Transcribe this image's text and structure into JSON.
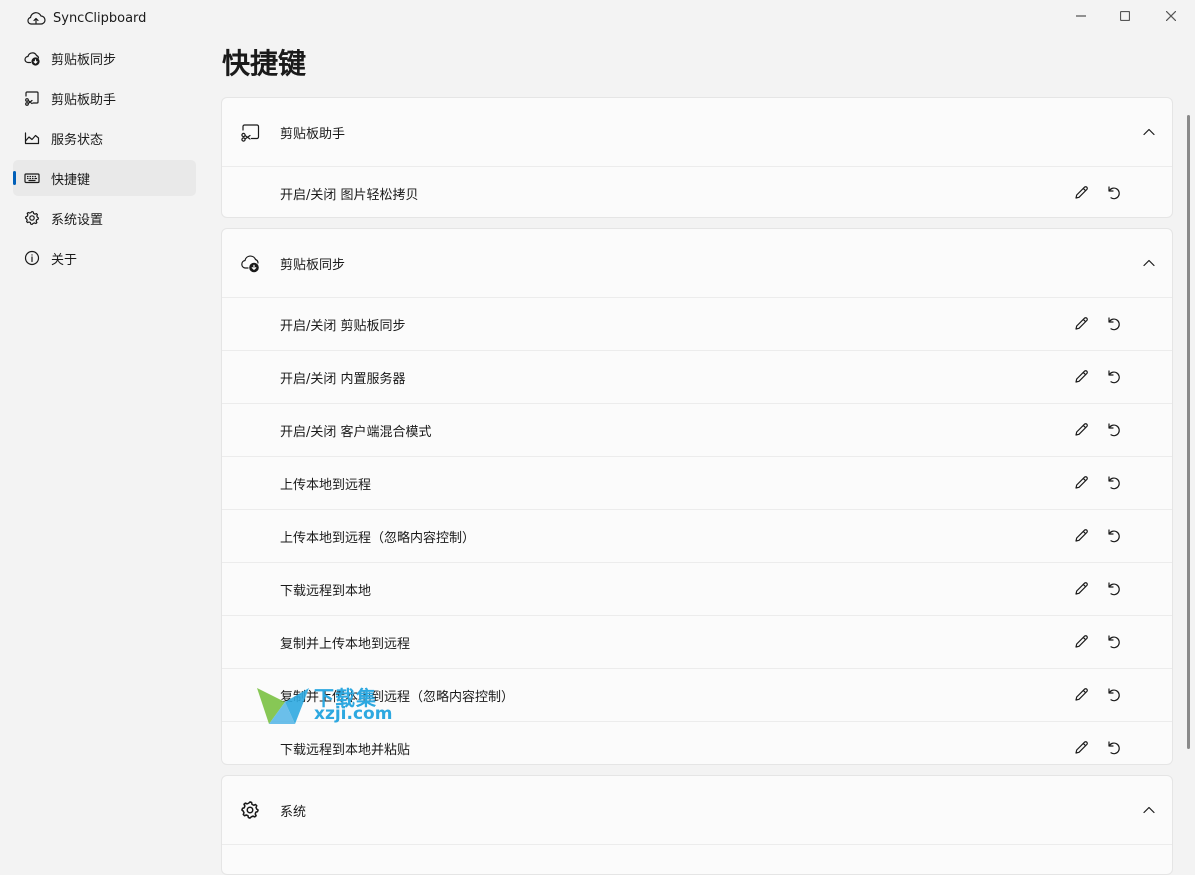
{
  "app": {
    "title": "SyncClipboard",
    "icons": {
      "app": "cloud-sync-icon",
      "minimize": "minimize-icon",
      "maximize": "maximize-icon",
      "close": "close-icon"
    }
  },
  "sidebar": {
    "items": [
      {
        "label": "剪贴板同步",
        "icon": "cloud-download-icon",
        "active": false
      },
      {
        "label": "剪贴板助手",
        "icon": "screenshot-scissors-icon",
        "active": false
      },
      {
        "label": "服务状态",
        "icon": "chart-area-icon",
        "active": false
      },
      {
        "label": "快捷键",
        "icon": "keyboard-icon",
        "active": true
      },
      {
        "label": "系统设置",
        "icon": "gear-icon",
        "active": false
      },
      {
        "label": "关于",
        "icon": "info-icon",
        "active": false
      }
    ]
  },
  "page": {
    "title": "快捷键"
  },
  "sections": {
    "assistant": {
      "label": "剪贴板助手",
      "icon": "screenshot-scissors-icon",
      "rows": [
        "开启/关闭 图片轻松拷贝"
      ]
    },
    "sync": {
      "label": "剪贴板同步",
      "icon": "cloud-download-icon",
      "rows": [
        "开启/关闭 剪贴板同步",
        "开启/关闭 内置服务器",
        "开启/关闭 客户端混合模式",
        "上传本地到远程",
        "上传本地到远程（忽略内容控制）",
        "下载远程到本地",
        "复制并上传本地到远程",
        "复制并上传本地到远程（忽略内容控制）",
        "下载远程到本地并粘贴"
      ]
    },
    "system": {
      "label": "系统",
      "icon": "gear-icon"
    }
  },
  "row_icons": {
    "edit": "pencil-icon",
    "reset": "undo-icon",
    "collapse": "chevron-up-icon"
  },
  "watermark": {
    "line1": "下载集",
    "line2": "xzji.com"
  },
  "colors": {
    "accent": "#005fb8",
    "background": "#f3f3f3",
    "card": "#fbfbfb",
    "watermark": "#2da8e0"
  }
}
